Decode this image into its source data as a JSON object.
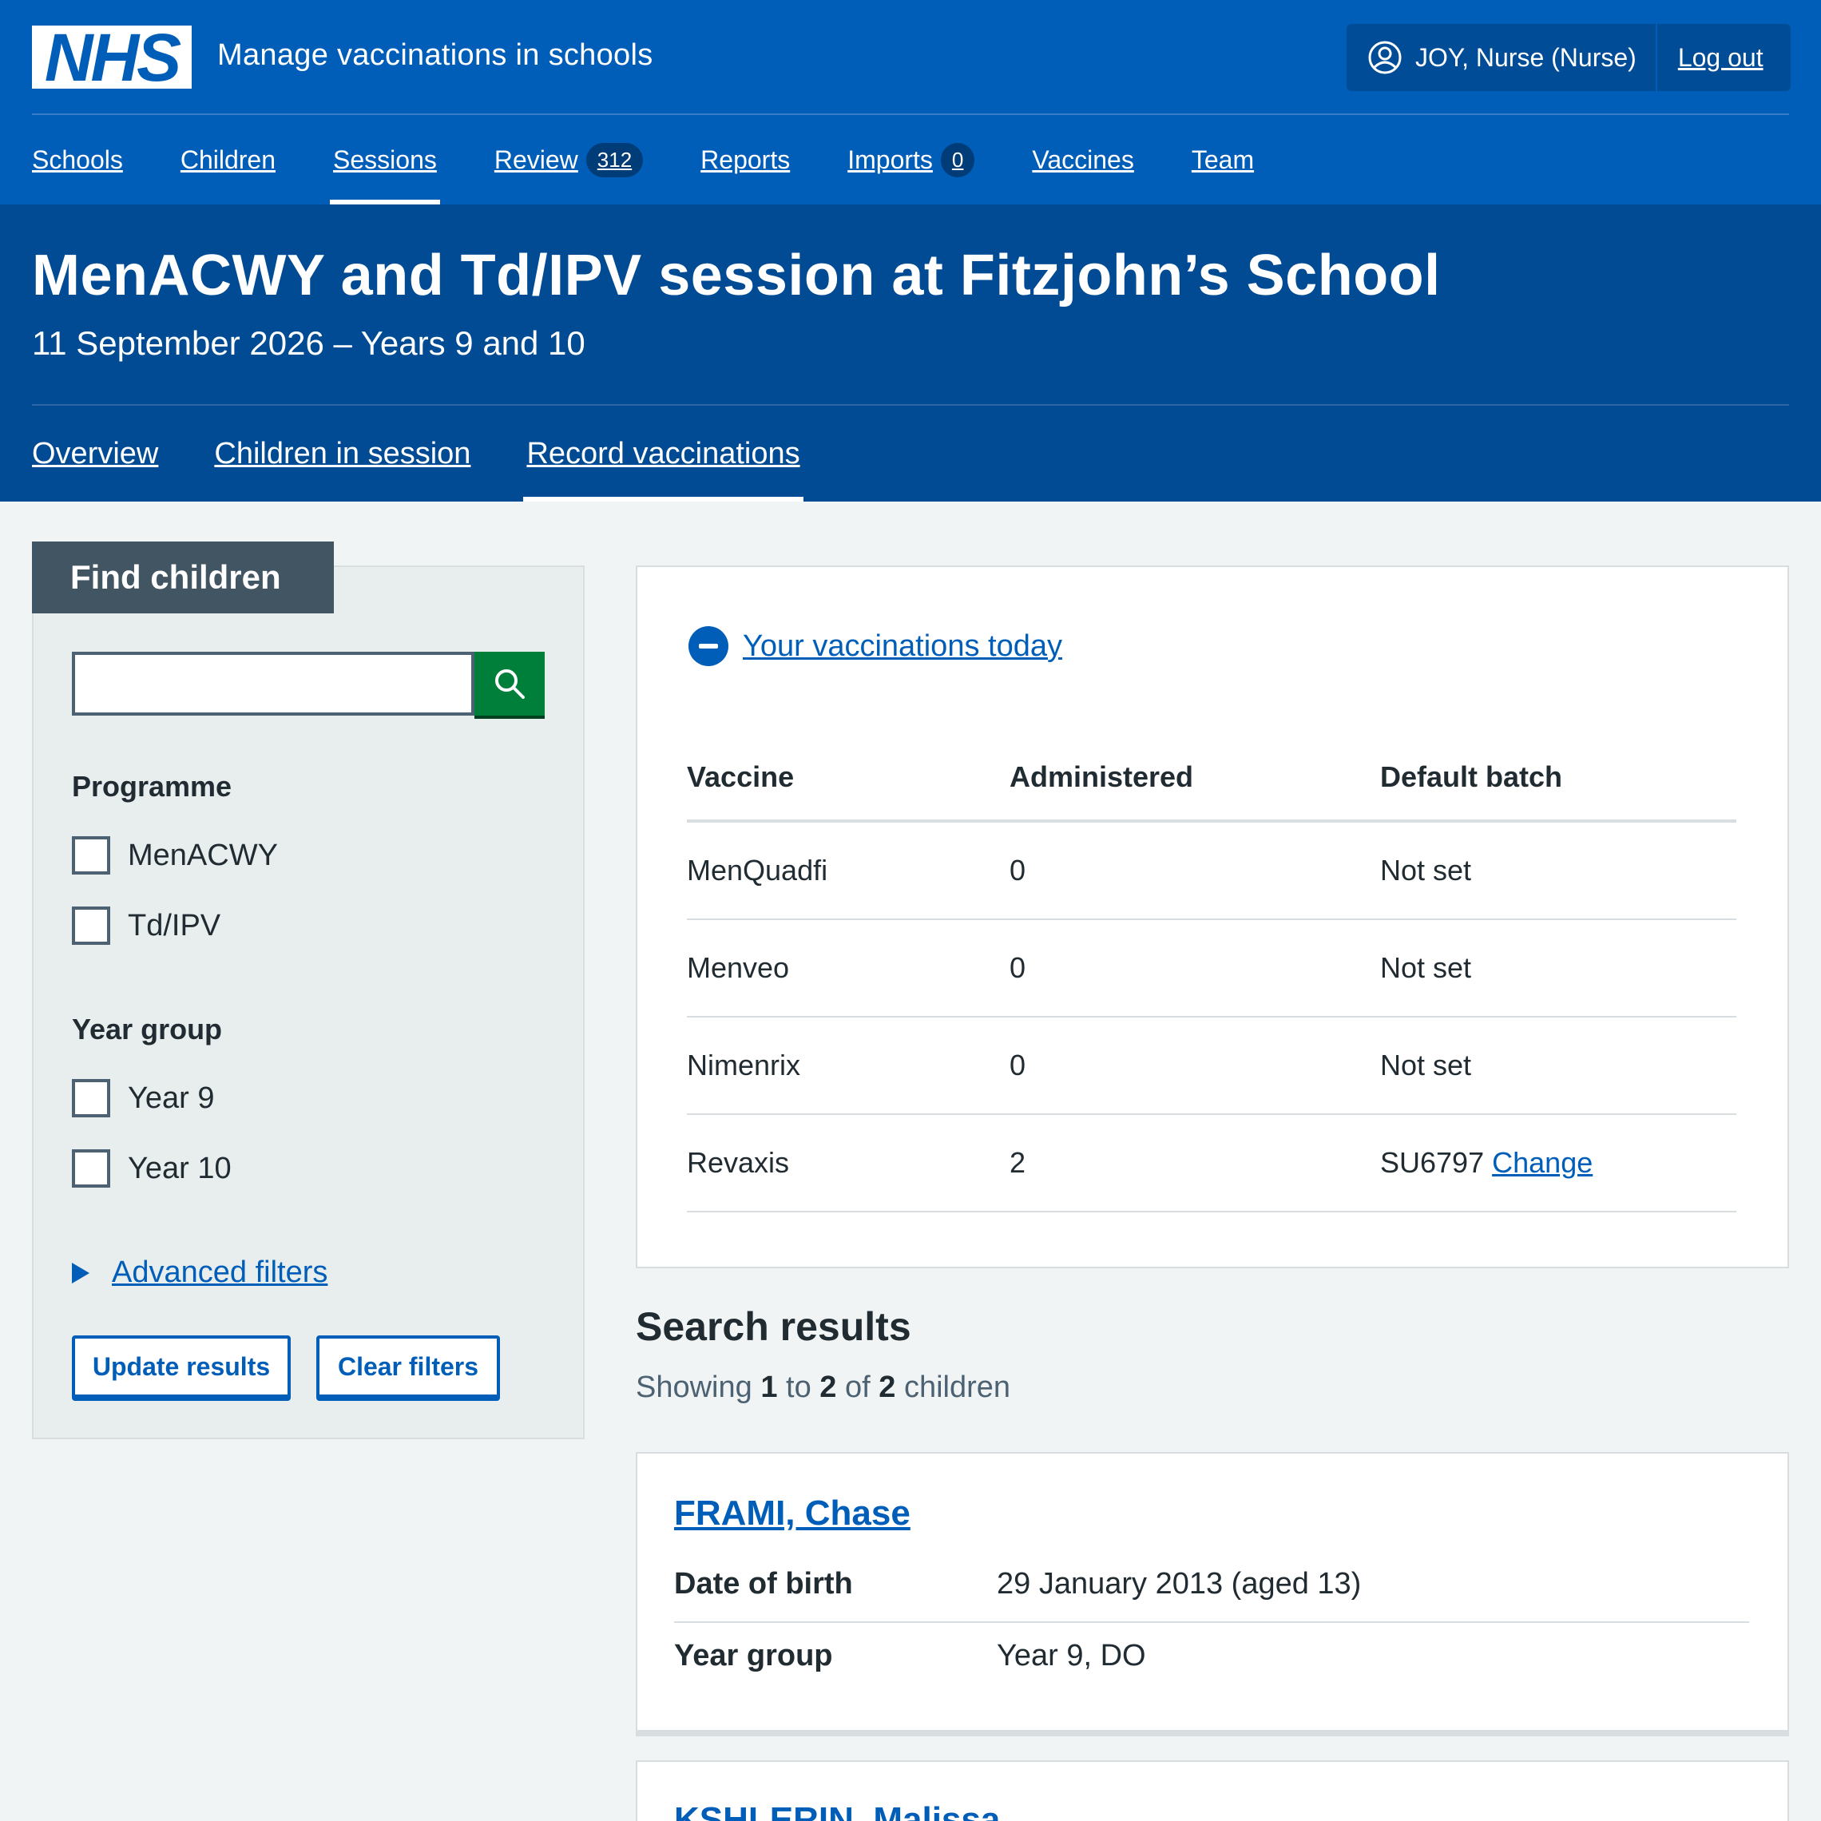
{
  "header": {
    "logo_text": "NHS",
    "service_name": "Manage vaccinations in schools",
    "user": "JOY, Nurse (Nurse)",
    "logout": "Log out"
  },
  "nav": [
    {
      "label": "Schools"
    },
    {
      "label": "Children"
    },
    {
      "label": "Sessions",
      "active": true
    },
    {
      "label": "Review",
      "badge": "312"
    },
    {
      "label": "Reports"
    },
    {
      "label": "Imports",
      "badge": "0"
    },
    {
      "label": "Vaccines"
    },
    {
      "label": "Team"
    }
  ],
  "session": {
    "title": "MenACWY and Td/IPV session at Fitzjohn’s School",
    "subtitle": "11 September 2026 – Years 9 and 10",
    "tabs": [
      {
        "label": "Overview"
      },
      {
        "label": "Children in session"
      },
      {
        "label": "Record vaccinations",
        "active": true
      }
    ]
  },
  "filters": {
    "heading": "Find children",
    "search_value": "",
    "programme_legend": "Programme",
    "programmes": [
      "MenACWY",
      "Td/IPV"
    ],
    "year_legend": "Year group",
    "years": [
      "Year 9",
      "Year 10"
    ],
    "advanced": "Advanced filters",
    "update_button": "Update results",
    "clear_button": "Clear filters"
  },
  "vaccinations": {
    "toggle_label": "Your vaccinations today",
    "columns": [
      "Vaccine",
      "Administered",
      "Default batch"
    ],
    "rows": [
      {
        "vaccine": "MenQuadfi",
        "administered": "0",
        "batch": "Not set",
        "change": ""
      },
      {
        "vaccine": "Menveo",
        "administered": "0",
        "batch": "Not set",
        "change": ""
      },
      {
        "vaccine": "Nimenrix",
        "administered": "0",
        "batch": "Not set",
        "change": ""
      },
      {
        "vaccine": "Revaxis",
        "administered": "2",
        "batch": "SU6797",
        "change": "Change"
      }
    ]
  },
  "results": {
    "title": "Search results",
    "summary_prefix": "Showing",
    "from": "1",
    "to_word": "to",
    "to": "2",
    "of_word": "of",
    "total": "2",
    "suffix": "children",
    "children": [
      {
        "name": "FRAMI, Chase",
        "dob_key": "Date of birth",
        "dob": "29 January 2013 (aged 13)",
        "year_key": "Year group",
        "year": "Year 9, DO"
      },
      {
        "name": "KSHLERIN, Malissa"
      }
    ]
  }
}
